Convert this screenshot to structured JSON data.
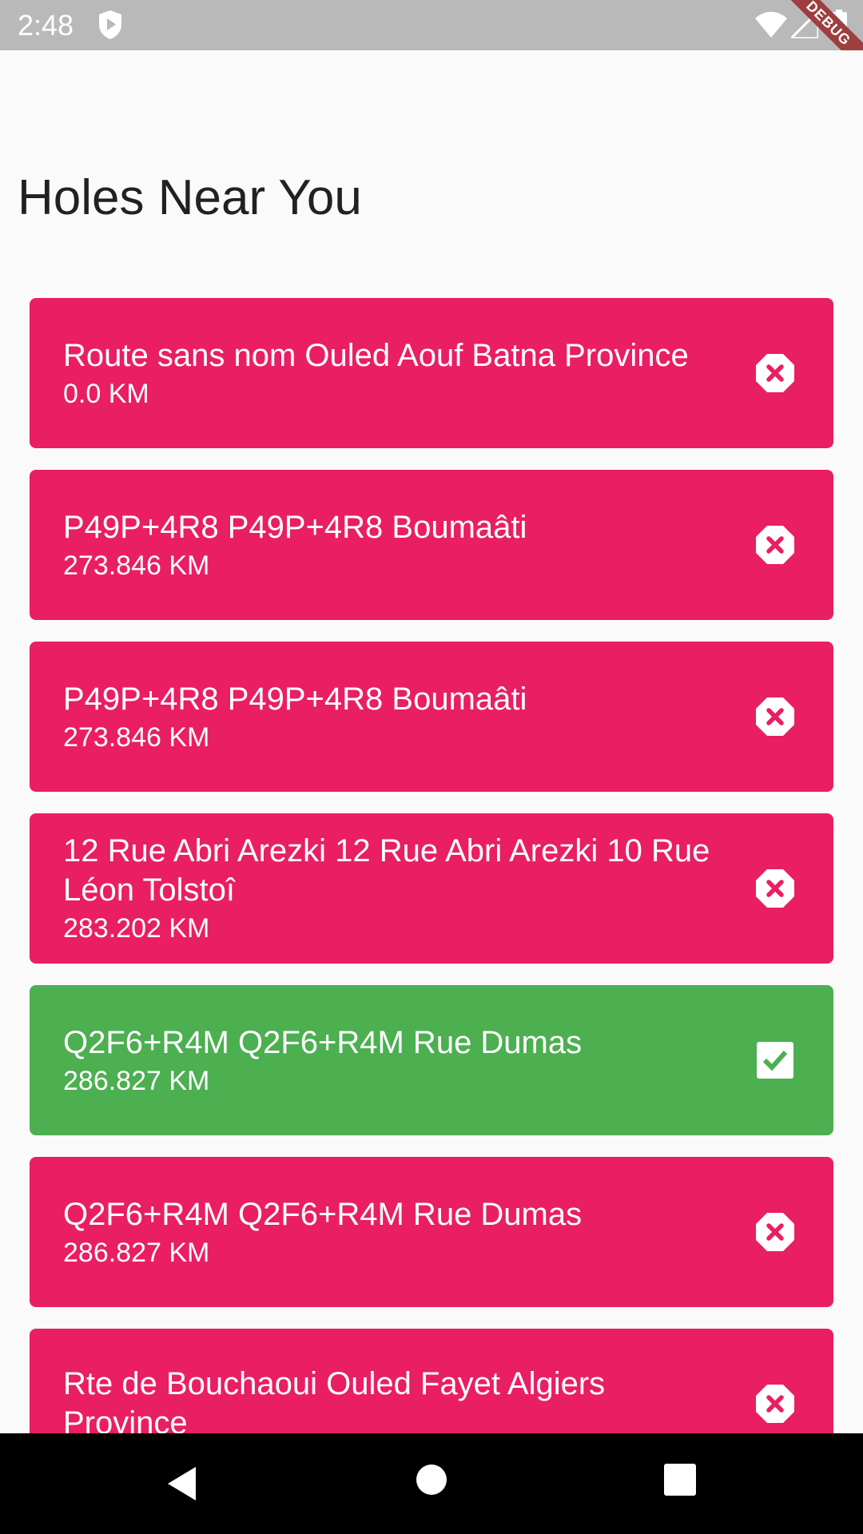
{
  "status_bar": {
    "time": "2:48",
    "debug_banner": "DEBUG"
  },
  "page": {
    "title": "Holes Near You"
  },
  "colors": {
    "unresolved": "#e91e63",
    "resolved": "#4caf50"
  },
  "holes": [
    {
      "name": "Route sans nom Ouled Aouf Batna Province",
      "distance": "0.0 KM",
      "status": "unresolved",
      "icon": "close-octagon-icon"
    },
    {
      "name": "P49P+4R8 P49P+4R8 Boumaâti",
      "distance": "273.846 KM",
      "status": "unresolved",
      "icon": "close-octagon-icon"
    },
    {
      "name": "P49P+4R8 P49P+4R8 Boumaâti",
      "distance": "273.846 KM",
      "status": "unresolved",
      "icon": "close-octagon-icon"
    },
    {
      "name": "12 Rue Abri Arezki 12 Rue Abri Arezki 10 Rue Léon Tolstoî",
      "distance": "283.202 KM",
      "status": "unresolved",
      "icon": "close-octagon-icon"
    },
    {
      "name": "Q2F6+R4M Q2F6+R4M Rue Dumas",
      "distance": "286.827 KM",
      "status": "resolved",
      "icon": "check-box-icon"
    },
    {
      "name": "Q2F6+R4M Q2F6+R4M Rue Dumas",
      "distance": "286.827 KM",
      "status": "unresolved",
      "icon": "close-octagon-icon"
    },
    {
      "name": "Rte de Bouchaoui Ouled Fayet Algiers Province",
      "distance": "",
      "status": "unresolved",
      "icon": "close-octagon-icon"
    }
  ]
}
